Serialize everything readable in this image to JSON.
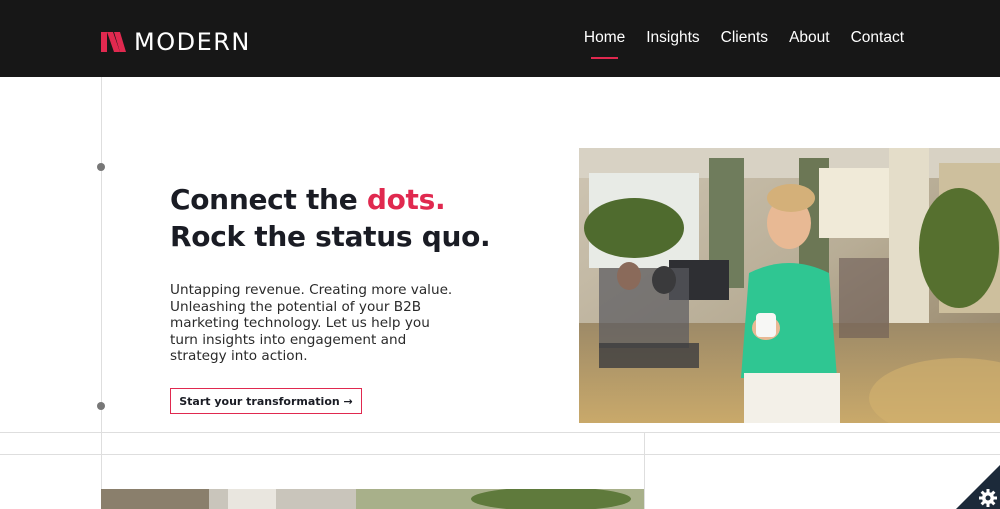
{
  "brand": {
    "name": "MODERN",
    "accent_color": "#e0294f",
    "header_bg": "#171717"
  },
  "nav": {
    "items": [
      {
        "label": "Home",
        "active": true
      },
      {
        "label": "Insights"
      },
      {
        "label": "Clients"
      },
      {
        "label": "About"
      },
      {
        "label": "Contact"
      }
    ]
  },
  "hero": {
    "headline_line1_prefix": "Connect the ",
    "headline_line1_accent": "dots.",
    "headline_line2": "Rock the status quo.",
    "body": "Untapping revenue. Creating more value. Unleashing the potential of your B2B marketing technology. Let us help you turn insights into engagement and strategy into action.",
    "cta_label": "Start your transformation →"
  },
  "icons": {
    "logo": "modern-logo-mark",
    "settings": "gear-icon"
  }
}
